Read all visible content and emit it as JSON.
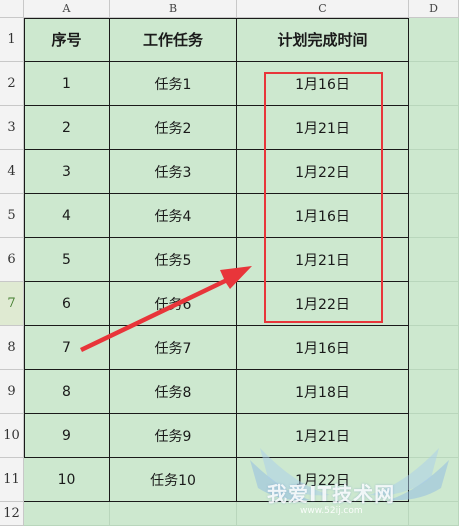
{
  "columns": [
    "A",
    "B",
    "C",
    "D"
  ],
  "rows": [
    "1",
    "2",
    "3",
    "4",
    "5",
    "6",
    "7",
    "8",
    "9",
    "10",
    "11",
    "12"
  ],
  "active_row": "7",
  "table": {
    "headers": [
      "序号",
      "工作任务",
      "计划完成时间"
    ],
    "data": [
      [
        "1",
        "任务1",
        "1月16日"
      ],
      [
        "2",
        "任务2",
        "1月21日"
      ],
      [
        "3",
        "任务3",
        "1月22日"
      ],
      [
        "4",
        "任务4",
        "1月16日"
      ],
      [
        "5",
        "任务5",
        "1月21日"
      ],
      [
        "6",
        "任务6",
        "1月22日"
      ],
      [
        "7",
        "任务7",
        "1月16日"
      ],
      [
        "8",
        "任务8",
        "1月18日"
      ],
      [
        "9",
        "任务9",
        "1月21日"
      ],
      [
        "10",
        "任务10",
        "1月22日"
      ]
    ]
  },
  "colors": {
    "cell_fill": "#cde8cf",
    "highlight_box": "#e8353a",
    "arrow": "#e8353a"
  },
  "watermark": {
    "text": "我爱IT技术网",
    "url": "www.52ij.com"
  }
}
